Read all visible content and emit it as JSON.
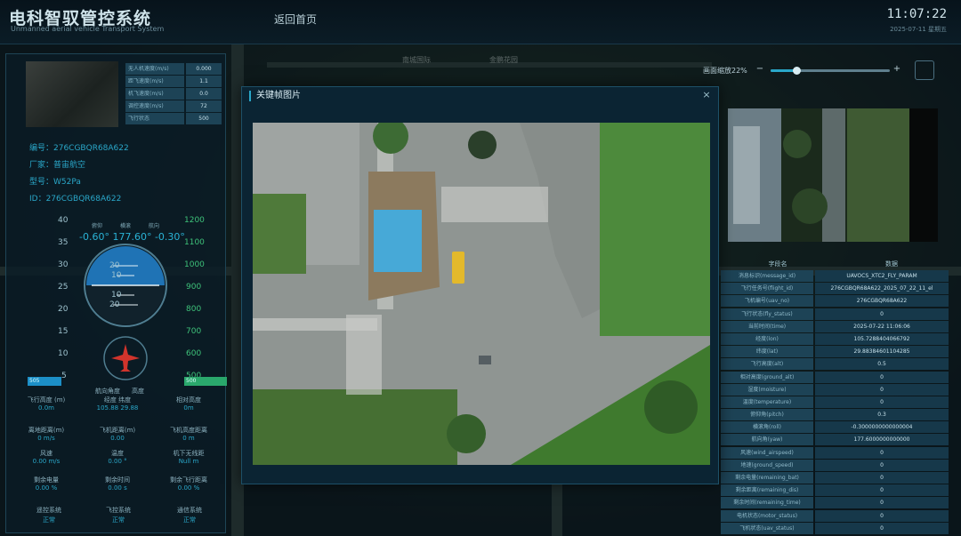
{
  "header": {
    "title": "电科智驭管控系统",
    "subtitle": "Unmanned aerial vehicle Transport System",
    "nav_home": "返回首页",
    "clock": "11:07:22",
    "date": "2025-07-11 星期五"
  },
  "left_panel": {
    "stats": [
      {
        "key": "无人机速度(m/s)",
        "value": "0.000"
      },
      {
        "key": "距飞速度(m/s)",
        "value": "1.1"
      },
      {
        "key": "机飞速度(m/s)",
        "value": "0.0"
      },
      {
        "key": "调控速度(m/s)",
        "value": "72"
      },
      {
        "key": "飞行状态",
        "value": "500"
      }
    ],
    "info": {
      "serial": "编号：276CGBQR68A622",
      "vendor": "厂家：普宙航空",
      "model": "型号：W52Pa",
      "id": "ID：276CGBQR68A622"
    },
    "attitude": {
      "pitch_label": "俯仰",
      "roll_label": "横滚",
      "yaw_label": "航向",
      "values": "-0.60° 177.60° -0.30°"
    },
    "scale_left": [
      "40",
      "35",
      "30",
      "25",
      "20",
      "15",
      "10",
      "5"
    ],
    "scale_right": [
      "1200",
      "1100",
      "1000",
      "900",
      "800",
      "700",
      "600",
      "500"
    ],
    "gauge_ticks": [
      "20",
      "10",
      "10",
      "20"
    ],
    "speed_bar": "505",
    "alt_bar": "500",
    "metrics_row1": [
      {
        "label": "飞行高度 (m)",
        "value": "0.0m"
      },
      {
        "label": "经度   纬度",
        "value": "105.88   29.88"
      },
      {
        "label": "相对高度",
        "value": "0m"
      }
    ],
    "heading_labels": {
      "heading": "航向角度",
      "text": "高度"
    },
    "metrics_row2": [
      {
        "label": "离地距离(m)",
        "value": "0 m/s"
      },
      {
        "label": "飞机距离(m)",
        "value": "0.00"
      },
      {
        "label": "飞机高度距离",
        "value": "0 m"
      }
    ],
    "metrics_row3": [
      {
        "label": "风速",
        "value": "0.00 m/s"
      },
      {
        "label": "温度",
        "value": "0.00 °"
      },
      {
        "label": "机下无线距",
        "value": "Null m"
      }
    ],
    "metrics_row4": [
      {
        "label": "剩余电量",
        "value": "0.00 %"
      },
      {
        "label": "剩余时间",
        "value": "0.00 s"
      },
      {
        "label": "剩余飞行距离",
        "value": "0.00 %"
      }
    ],
    "modes": [
      {
        "label": "遥控系统",
        "value": "正常"
      },
      {
        "label": "飞控系统",
        "value": "正常"
      },
      {
        "label": "通信系统",
        "value": "正常"
      }
    ]
  },
  "right_panel": {
    "zoom_label": "画面缩放22%",
    "zoom_level": 0.22,
    "table_headers": {
      "field": "字段名",
      "value": "数据"
    },
    "rows": [
      {
        "k": "消息标识(message_id)",
        "v": "UAVOCS_XTC2_FLY_PARAM"
      },
      {
        "k": "飞行任务号(flight_id)",
        "v": "276CGBQR68A622_2025_07_22_11_el"
      },
      {
        "k": "飞机编号(uav_no)",
        "v": "276CGBQR68A622"
      },
      {
        "k": "飞行状态(fly_status)",
        "v": "0"
      },
      {
        "k": "当前时间(time)",
        "v": "2025-07-22 11:06:06"
      },
      {
        "k": "经度(lon)",
        "v": "105.7288404066792"
      },
      {
        "k": "纬度(lat)",
        "v": "29.88384601104285"
      },
      {
        "k": "飞行高度(alt)",
        "v": "0.5"
      },
      {
        "k": "相对高度(ground_alt)",
        "v": "0"
      },
      {
        "k": "湿度(moisture)",
        "v": "0"
      },
      {
        "k": "温度(temperature)",
        "v": "0"
      },
      {
        "k": "俯仰角(pitch)",
        "v": "0.3"
      },
      {
        "k": "横滚角(roll)",
        "v": "-0.3000000000000004"
      },
      {
        "k": "航向角(yaw)",
        "v": "177.6000000000000"
      },
      {
        "k": "风速(wind_airspeed)",
        "v": "0"
      },
      {
        "k": "地速(ground_speed)",
        "v": "0"
      },
      {
        "k": "剩余电量(remaining_bat)",
        "v": "0"
      },
      {
        "k": "剩余距离(remaining_dis)",
        "v": "0"
      },
      {
        "k": "剩余时间(remaining_time)",
        "v": "0"
      },
      {
        "k": "电机状态(motor_status)",
        "v": "0"
      },
      {
        "k": "飞机状态(uav_status)",
        "v": "0"
      }
    ]
  },
  "map_labels": [
    "南城国际",
    "金鹏花园"
  ],
  "modal": {
    "title": "关键帧图片",
    "close": "×"
  }
}
